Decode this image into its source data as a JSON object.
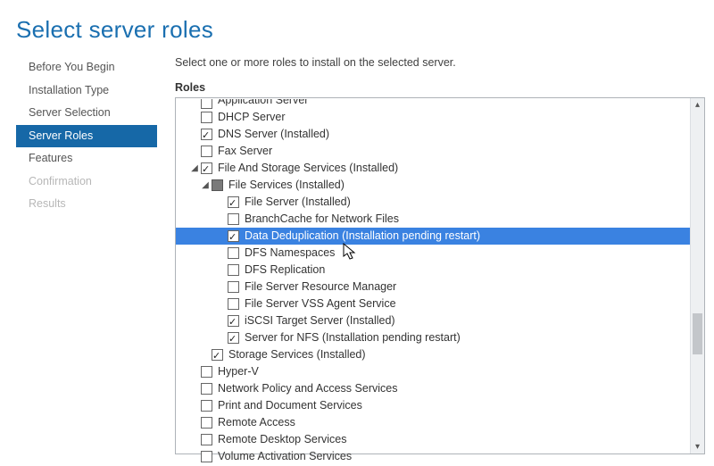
{
  "title": "Select server roles",
  "sidebar": {
    "items": [
      {
        "label": "Before You Begin",
        "active": false,
        "disabled": false
      },
      {
        "label": "Installation Type",
        "active": false,
        "disabled": false
      },
      {
        "label": "Server Selection",
        "active": false,
        "disabled": false
      },
      {
        "label": "Server Roles",
        "active": true,
        "disabled": false
      },
      {
        "label": "Features",
        "active": false,
        "disabled": false
      },
      {
        "label": "Confirmation",
        "active": false,
        "disabled": true
      },
      {
        "label": "Results",
        "active": false,
        "disabled": true
      }
    ]
  },
  "main": {
    "instruction": "Select one or more roles to install on the selected server.",
    "roles_label": "Roles"
  },
  "roles": [
    {
      "id": "application-server",
      "label": "Application Server",
      "indent": 1,
      "checked": false,
      "exp": "none",
      "trunc": true
    },
    {
      "id": "dhcp-server",
      "label": "DHCP Server",
      "indent": 1,
      "checked": false,
      "exp": "none"
    },
    {
      "id": "dns-server",
      "label": "DNS Server (Installed)",
      "indent": 1,
      "checked": true,
      "exp": "none"
    },
    {
      "id": "fax-server",
      "label": "Fax Server",
      "indent": 1,
      "checked": false,
      "exp": "none"
    },
    {
      "id": "file-storage",
      "label": "File And Storage Services (Installed)",
      "indent": 1,
      "checked": true,
      "exp": "open"
    },
    {
      "id": "file-services",
      "label": "File Services (Installed)",
      "indent": 2,
      "checked": "filled",
      "exp": "open"
    },
    {
      "id": "file-server",
      "label": "File Server (Installed)",
      "indent": 3,
      "checked": true,
      "exp": "none"
    },
    {
      "id": "branchcache",
      "label": "BranchCache for Network Files",
      "indent": 3,
      "checked": false,
      "exp": "none"
    },
    {
      "id": "data-dedup",
      "label": "Data Deduplication (Installation pending restart)",
      "indent": 3,
      "checked": true,
      "exp": "none",
      "selected": true
    },
    {
      "id": "dfs-namespaces",
      "label": "DFS Namespaces",
      "indent": 3,
      "checked": false,
      "exp": "none"
    },
    {
      "id": "dfs-replication",
      "label": "DFS Replication",
      "indent": 3,
      "checked": false,
      "exp": "none"
    },
    {
      "id": "fsrm",
      "label": "File Server Resource Manager",
      "indent": 3,
      "checked": false,
      "exp": "none"
    },
    {
      "id": "vss-agent",
      "label": "File Server VSS Agent Service",
      "indent": 3,
      "checked": false,
      "exp": "none"
    },
    {
      "id": "iscsi-target",
      "label": "iSCSI Target Server (Installed)",
      "indent": 3,
      "checked": true,
      "exp": "none"
    },
    {
      "id": "nfs-server",
      "label": "Server for NFS (Installation pending restart)",
      "indent": 3,
      "checked": true,
      "exp": "none"
    },
    {
      "id": "storage-services",
      "label": "Storage Services (Installed)",
      "indent": 2,
      "checked": true,
      "exp": "none"
    },
    {
      "id": "hyper-v",
      "label": "Hyper-V",
      "indent": 1,
      "checked": false,
      "exp": "none"
    },
    {
      "id": "network-policy",
      "label": "Network Policy and Access Services",
      "indent": 1,
      "checked": false,
      "exp": "none"
    },
    {
      "id": "print-doc",
      "label": "Print and Document Services",
      "indent": 1,
      "checked": false,
      "exp": "none"
    },
    {
      "id": "remote-access",
      "label": "Remote Access",
      "indent": 1,
      "checked": false,
      "exp": "none"
    },
    {
      "id": "rds",
      "label": "Remote Desktop Services",
      "indent": 1,
      "checked": false,
      "exp": "none"
    },
    {
      "id": "vol-activation",
      "label": "Volume Activation Services",
      "indent": 1,
      "checked": false,
      "exp": "none"
    }
  ],
  "icons": {
    "cursor": "cursor-icon",
    "scroll_up": "▴",
    "scroll_down": "▾",
    "expander_open": "◢",
    "expander_closed": "▷"
  }
}
